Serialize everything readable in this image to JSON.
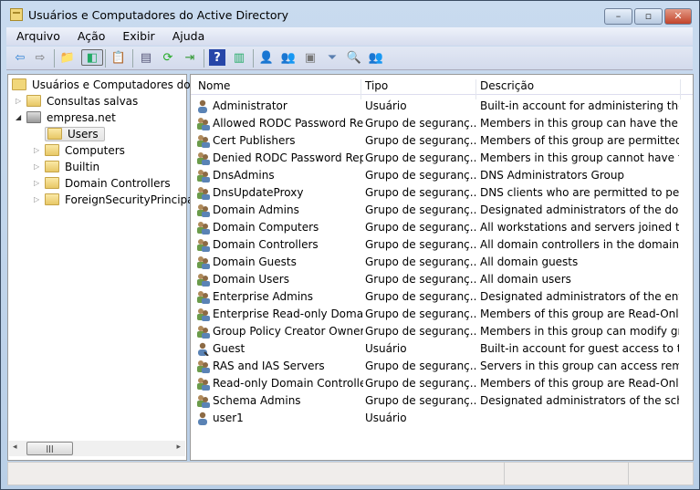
{
  "window": {
    "title": "Usuários e Computadores do Active Directory",
    "minimize": "–",
    "maximize": "▫",
    "close": "✕"
  },
  "menu": [
    "Arquivo",
    "Ação",
    "Exibir",
    "Ajuda"
  ],
  "toolbar": [
    {
      "icon": "back-arrow-icon",
      "glyph": "⇦",
      "color": "#2a7fd4"
    },
    {
      "icon": "forward-arrow-icon",
      "glyph": "⇨",
      "color": "#777"
    },
    {
      "icon": "up-folder-icon",
      "glyph": "📁",
      "color": "#c90"
    },
    {
      "icon": "show-hide-console-tree-icon",
      "glyph": "◧",
      "color": "#2a6"
    },
    {
      "icon": "clipboard-icon",
      "glyph": "📋",
      "color": "#333"
    },
    {
      "icon": "properties-icon",
      "glyph": "▤",
      "color": "#557"
    },
    {
      "icon": "refresh-icon",
      "glyph": "⟳",
      "color": "#2a2"
    },
    {
      "icon": "export-list-icon",
      "glyph": "⇥",
      "color": "#393"
    },
    {
      "icon": "help-icon",
      "glyph": "?",
      "color": "#fff"
    },
    {
      "icon": "show-action-pane-icon",
      "glyph": "▥",
      "color": "#2a6"
    },
    {
      "icon": "new-user-icon",
      "glyph": "👤",
      "color": "#345"
    },
    {
      "icon": "new-group-icon",
      "glyph": "👥",
      "color": "#574"
    },
    {
      "icon": "new-ou-icon",
      "glyph": "▣",
      "color": "#777"
    },
    {
      "icon": "filter-icon",
      "glyph": "⏷",
      "color": "#5a7fb0"
    },
    {
      "icon": "find-icon",
      "glyph": "🔍",
      "color": "#b90"
    },
    {
      "icon": "add-to-group-icon",
      "glyph": "👥",
      "color": "#888"
    }
  ],
  "tree": {
    "root": "Usuários e Computadores do Active Directory",
    "saved_queries": "Consultas salvas",
    "domain": "empresa.net",
    "children": [
      "Users",
      "Computers",
      "Builtin",
      "Domain Controllers",
      "ForeignSecurityPrincipals"
    ],
    "selected": "Users"
  },
  "list": {
    "columns": [
      "Nome",
      "Tipo",
      "Descrição"
    ],
    "rows": [
      {
        "name": "Administrator",
        "type": "Usuário",
        "desc": "Built-in account for administering the c...",
        "kind": "user"
      },
      {
        "name": "Allowed RODC Password Re...",
        "type": "Grupo de seguranç...",
        "desc": "Members in this group can have their p...",
        "kind": "group"
      },
      {
        "name": "Cert Publishers",
        "type": "Grupo de seguranç...",
        "desc": "Members of this group are permitted to...",
        "kind": "group"
      },
      {
        "name": "Denied RODC Password Repl...",
        "type": "Grupo de seguranç...",
        "desc": "Members in this group cannot have the...",
        "kind": "group"
      },
      {
        "name": "DnsAdmins",
        "type": "Grupo de seguranç...",
        "desc": "DNS Administrators Group",
        "kind": "group"
      },
      {
        "name": "DnsUpdateProxy",
        "type": "Grupo de seguranç...",
        "desc": "DNS clients who are permitted to perfor...",
        "kind": "group"
      },
      {
        "name": "Domain Admins",
        "type": "Grupo de seguranç...",
        "desc": "Designated administrators of the domain",
        "kind": "group"
      },
      {
        "name": "Domain Computers",
        "type": "Grupo de seguranç...",
        "desc": "All workstations and servers joined to t...",
        "kind": "group"
      },
      {
        "name": "Domain Controllers",
        "type": "Grupo de seguranç...",
        "desc": "All domain controllers in the domain",
        "kind": "group"
      },
      {
        "name": "Domain Guests",
        "type": "Grupo de seguranç...",
        "desc": "All domain guests",
        "kind": "group"
      },
      {
        "name": "Domain Users",
        "type": "Grupo de seguranç...",
        "desc": "All domain users",
        "kind": "group"
      },
      {
        "name": "Enterprise Admins",
        "type": "Grupo de seguranç...",
        "desc": "Designated administrators of the enterp...",
        "kind": "group"
      },
      {
        "name": "Enterprise Read-only Domai...",
        "type": "Grupo de seguranç...",
        "desc": "Members of this group are Read-Only ...",
        "kind": "group"
      },
      {
        "name": "Group Policy Creator Owners",
        "type": "Grupo de seguranç...",
        "desc": "Members in this group can modify gro...",
        "kind": "group"
      },
      {
        "name": "Guest",
        "type": "Usuário",
        "desc": "Built-in account for guest access to the ...",
        "kind": "user-disabled"
      },
      {
        "name": "RAS and IAS Servers",
        "type": "Grupo de seguranç...",
        "desc": "Servers in this group can access remote...",
        "kind": "group"
      },
      {
        "name": "Read-only Domain Controllers",
        "type": "Grupo de seguranç...",
        "desc": "Members of this group are Read-Only ...",
        "kind": "group"
      },
      {
        "name": "Schema Admins",
        "type": "Grupo de seguranç...",
        "desc": "Designated administrators of the schema",
        "kind": "group"
      },
      {
        "name": "user1",
        "type": "Usuário",
        "desc": "",
        "kind": "user"
      }
    ]
  }
}
